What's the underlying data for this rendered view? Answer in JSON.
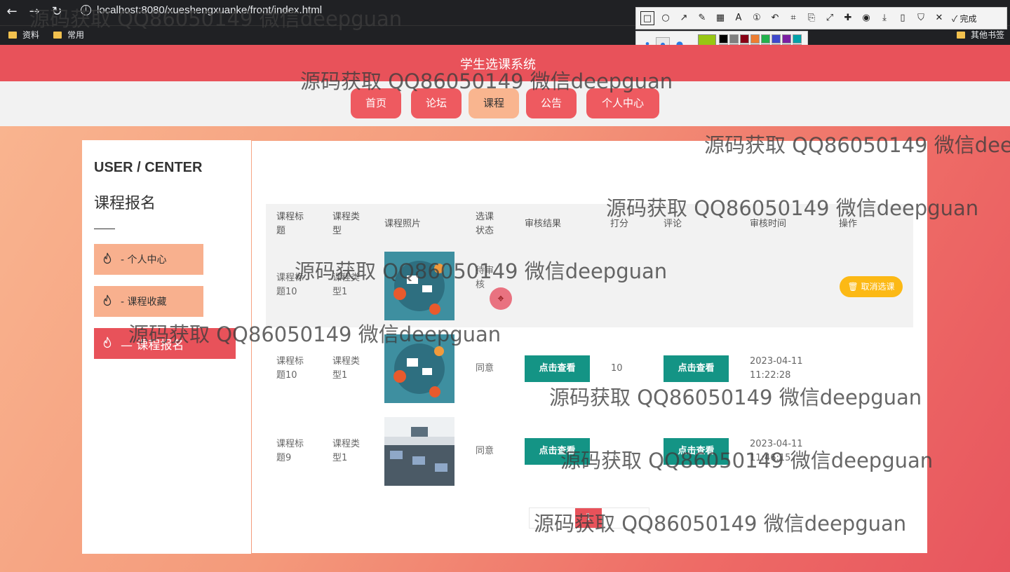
{
  "browser": {
    "url": "localhost:8080/xueshengxuanke/front/index.html",
    "bookmarks": [
      "资料",
      "常用"
    ],
    "other_bookmarks": "其他书签",
    "snip_done": "完成"
  },
  "site": {
    "title": "学生选课系统",
    "nav": [
      {
        "label": "首页"
      },
      {
        "label": "论坛"
      },
      {
        "label": "课程",
        "active": true
      },
      {
        "label": "公告"
      },
      {
        "label": "个人中心"
      }
    ]
  },
  "sidebar": {
    "heading_en": "USER / CENTER",
    "heading_cn": "课程报名",
    "items": [
      {
        "label": "-  个人中心"
      },
      {
        "label": "-  课程收藏"
      },
      {
        "label": "—   课程报名",
        "active": true
      }
    ]
  },
  "table": {
    "headers": [
      "课程标题",
      "课程类型",
      "课程照片",
      "选课状态",
      "审核结果",
      "打分",
      "评论",
      "审核时间",
      "操作"
    ],
    "rows": [
      {
        "title": "课程标题10",
        "type": "课程类型1",
        "status": "待审核",
        "action": "取消选课"
      },
      {
        "title": "课程标题10",
        "type": "课程类型1",
        "status": "同意",
        "result_btn": "点击查看",
        "score": "10",
        "comment_btn": "点击查看",
        "time": "2023-04-11 11:22:28"
      },
      {
        "title": "课程标题9",
        "type": "课程类型1",
        "status": "同意",
        "result_btn": "点击查看",
        "score": "",
        "comment_btn": "点击查看",
        "time": "2023-04-11 11:46:15"
      }
    ]
  },
  "pager": {
    "current": "1"
  },
  "watermark": "源码获取 QQ86050149 微信deepguan",
  "colors": {
    "header": "#e8525a",
    "nav_active": "#f9b58f",
    "teal_button": "#149485",
    "cancel_button": "#fcb915"
  }
}
